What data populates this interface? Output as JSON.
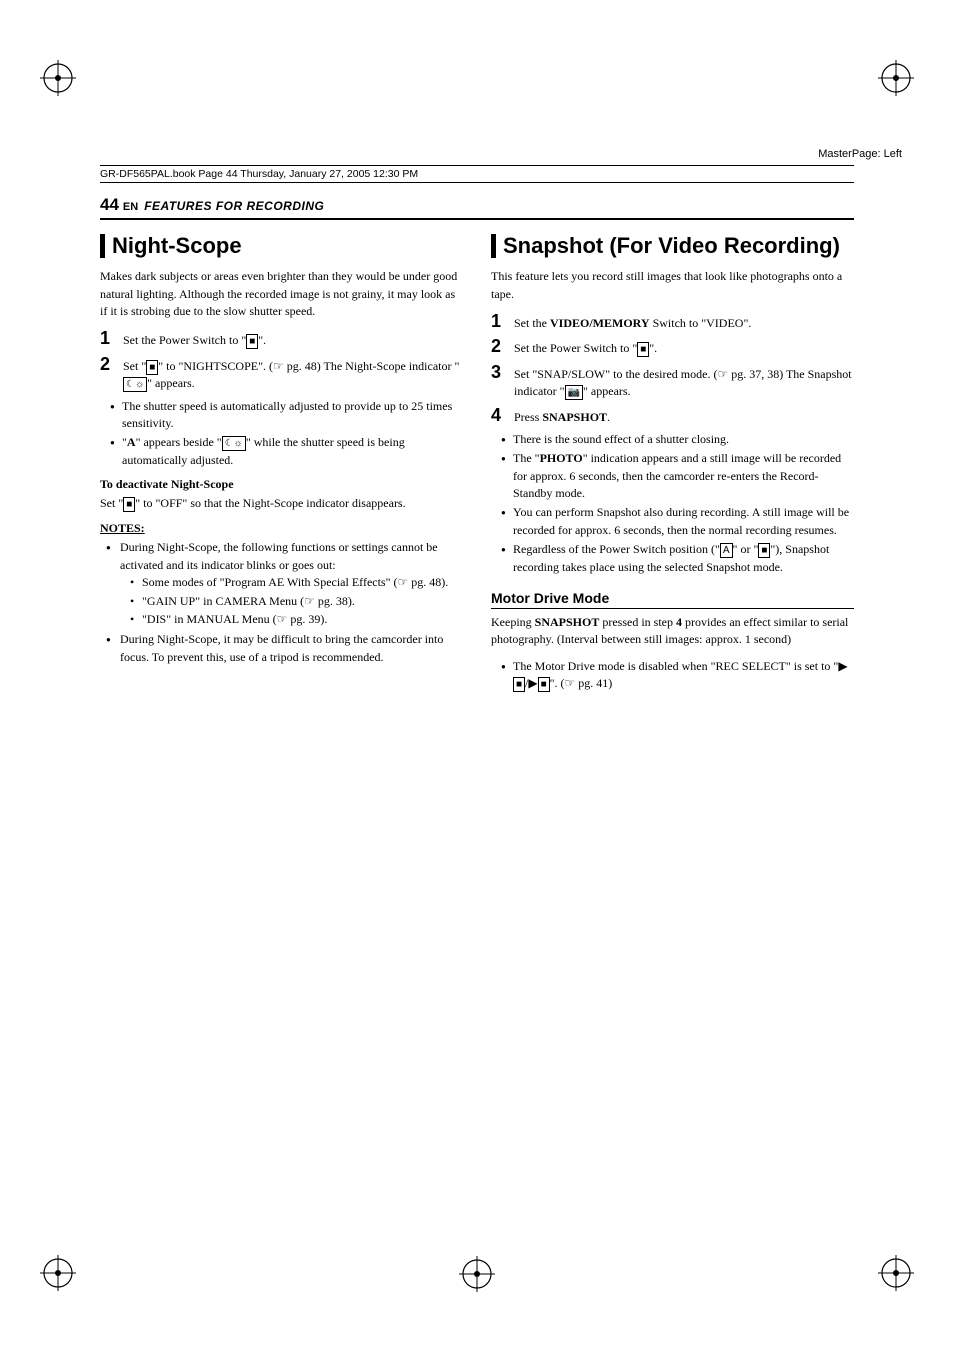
{
  "meta": {
    "masterLabel": "MasterPage: Left",
    "fileInfo": "GR-DF565PAL.book  Page 44  Thursday, January 27, 2005  12:30 PM"
  },
  "header": {
    "pageNumber": "44",
    "superscript": "EN",
    "sectionTitle": "FEATURES FOR RECORDING"
  },
  "leftColumn": {
    "heading": "Night-Scope",
    "intro": "Makes dark subjects or areas even brighter than they would be under good natural lighting. Although the recorded image is not grainy, it may look as if it is strobing due to the slow shutter speed.",
    "steps": [
      {
        "num": "1",
        "text": "Set the Power Switch to \"■\"."
      },
      {
        "num": "2",
        "text": "Set \"■\" to \"NIGHTSCOPE\". (↗ pg. 48) The Night-Scope indicator \"■\" appears."
      }
    ],
    "bullets": [
      "The shutter speed is automatically adjusted to provide up to 25 times sensitivity.",
      "“A” appears beside \"■\" while the shutter speed is being automatically adjusted."
    ],
    "deactivateHeading": "To deactivate Night-Scope",
    "deactivateText": "Set \"■\" to \"OFF\" so that the Night-Scope indicator disappears.",
    "notesHeading": "NOTES:",
    "notes": [
      "During Night-Scope, the following functions or settings cannot be activated and its indicator blinks or goes out:",
      "During Night-Scope, it may be difficult to bring the camcorder into focus. To prevent this, use of a tripod is recommended."
    ],
    "notesSubs": [
      "Some modes of “Program AE With Special Effects” (↗ pg. 48).",
      "“GAIN UP” in CAMERA Menu (↗ pg. 38).",
      "“DIS” in MANUAL Menu (↗ pg. 39)."
    ]
  },
  "rightColumn": {
    "heading": "Snapshot (For Video Recording)",
    "intro": "This feature lets you record still images that look like photographs onto a tape.",
    "steps": [
      {
        "num": "1",
        "text": "Set the VIDEO/MEMORY Switch to \"VIDEO\"."
      },
      {
        "num": "2",
        "text": "Set the Power Switch to \"■\"."
      },
      {
        "num": "3",
        "text": "Set \"SNAP/SLOW\" to the desired mode. (↗ pg. 37, 38) The Snapshot indicator \"■\" appears."
      },
      {
        "num": "4",
        "text": "Press SNAPSHOT."
      }
    ],
    "bullets": [
      "There is the sound effect of a shutter closing.",
      "The “PHOTO” indication appears and a still image will be recorded for approx. 6 seconds, then the camcorder re-enters the Record-Standby mode.",
      "You can perform Snapshot also during recording. A still image will be recorded for approx. 6 seconds, then the normal recording resumes.",
      "Regardless of the Power Switch position (\"■\" or \"■\"), Snapshot recording takes place using the selected Snapshot mode."
    ],
    "motorDriveHeading": "Motor Drive Mode",
    "motorDriveText": "Keeping SNAPSHOT pressed in step 4 provides an effect similar to serial photography. (Interval between still images: approx. 1 second)",
    "motorDriveBullets": [
      "The Motor Drive mode is disabled when \"REC SELECT\" is set to \"►■/►■\". (↗ pg. 41)"
    ]
  }
}
